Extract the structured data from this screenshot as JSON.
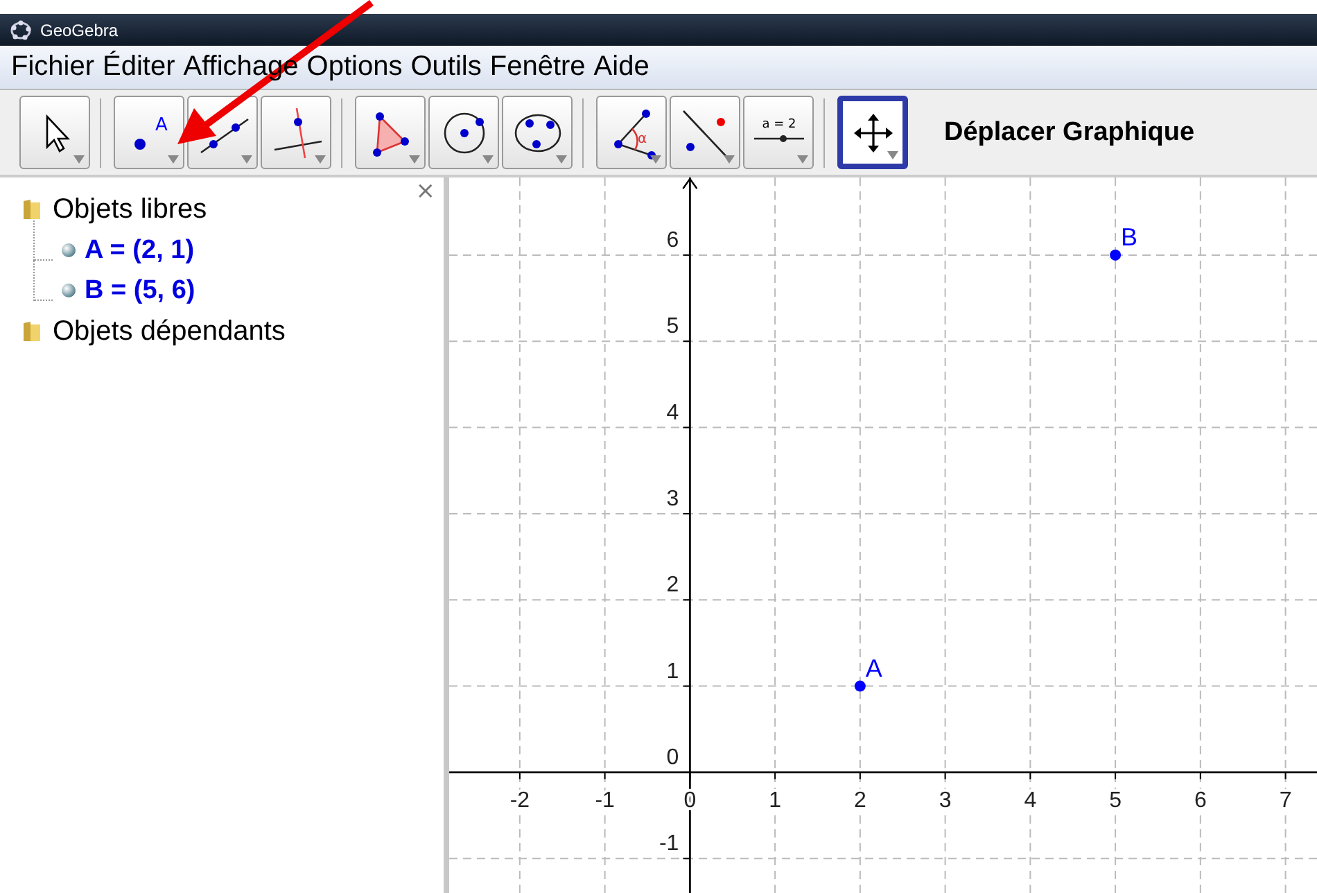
{
  "window": {
    "title": "GeoGebra"
  },
  "menu": [
    "Fichier",
    "Éditer",
    "Affichage",
    "Options",
    "Outils",
    "Fenêtre",
    "Aide"
  ],
  "toolbar": {
    "groups": [
      [
        {
          "kind": "move",
          "selected": false
        }
      ],
      [
        {
          "kind": "point",
          "label": "A",
          "selected": false
        },
        {
          "kind": "line",
          "selected": false
        },
        {
          "kind": "perpendicular",
          "selected": false
        }
      ],
      [
        {
          "kind": "polygon",
          "selected": false
        },
        {
          "kind": "circle",
          "selected": false
        },
        {
          "kind": "conic",
          "selected": false
        }
      ],
      [
        {
          "kind": "angle",
          "label": "α",
          "selected": false
        },
        {
          "kind": "reflect",
          "selected": false
        },
        {
          "kind": "slider",
          "label": "a = 2",
          "selected": false
        }
      ],
      [
        {
          "kind": "move-graphics",
          "selected": true
        }
      ]
    ],
    "tool_name": "Déplacer Graphique"
  },
  "algebra": {
    "close": "×",
    "folders": [
      {
        "label": "Objets libres",
        "children": [
          {
            "label": "A = (2, 1)"
          },
          {
            "label": "B = (5, 6)"
          }
        ]
      },
      {
        "label": "Objets dépendants"
      }
    ]
  },
  "graphics": {
    "chart_data": {
      "type": "scatter",
      "x": [
        2,
        5
      ],
      "series": [
        {
          "color": "#0000ff",
          "values": [
            1,
            6
          ]
        }
      ],
      "grid": true,
      "xlim": [
        -2.83,
        7.37
      ],
      "ylim": [
        -1.4,
        6.9
      ],
      "xticks": [
        -2,
        -1,
        0,
        1,
        2,
        3,
        4,
        5,
        6,
        7
      ],
      "yticks": [
        -1,
        0,
        1,
        2,
        3,
        4,
        5,
        6
      ]
    },
    "point_labels": [
      "A",
      "B"
    ]
  }
}
